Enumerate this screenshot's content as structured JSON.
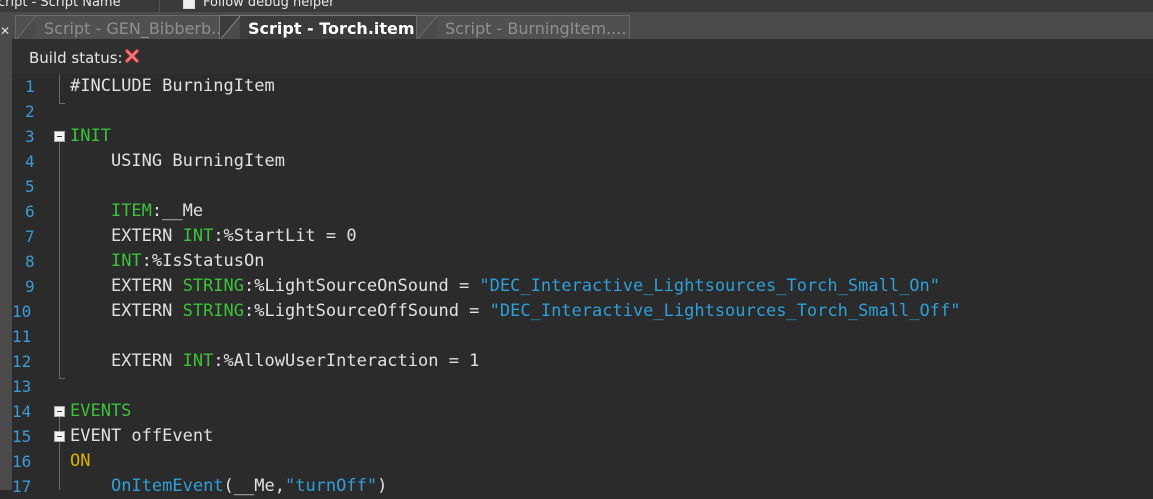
{
  "top_bar": {
    "left_text": "cript - Script Name",
    "right_text": "Follow debug helper"
  },
  "tabs": [
    {
      "label": "Script - GEN_Bibberb...",
      "active": false
    },
    {
      "label": "Script - Torch.item...",
      "active": true
    },
    {
      "label": "Script - BurningItem....",
      "active": false
    }
  ],
  "status": {
    "label": "Build status:",
    "icon": "error-x-icon",
    "icon_color": "#e84a4a"
  },
  "colors": {
    "keyword_green": "#3ac23a",
    "keyword_yellow": "#d9b300",
    "string_blue": "#2e9fd8",
    "line_number": "#3d9ad6",
    "background": "#2b2b2b"
  },
  "lines": [
    {
      "n": "1",
      "tokens": [
        {
          "t": "#INCLUDE BurningItem",
          "c": ""
        }
      ]
    },
    {
      "n": "2",
      "tokens": []
    },
    {
      "n": "3",
      "tokens": [
        {
          "t": "INIT",
          "c": "kw-green"
        }
      ]
    },
    {
      "n": "4",
      "tokens": [
        {
          "t": "    USING BurningItem",
          "c": ""
        }
      ]
    },
    {
      "n": "5",
      "tokens": []
    },
    {
      "n": "6",
      "tokens": [
        {
          "t": "    ",
          "c": ""
        },
        {
          "t": "ITEM",
          "c": "kw-green"
        },
        {
          "t": ":__Me",
          "c": ""
        }
      ]
    },
    {
      "n": "7",
      "tokens": [
        {
          "t": "    EXTERN ",
          "c": ""
        },
        {
          "t": "INT",
          "c": "kw-green"
        },
        {
          "t": ":%StartLit = 0",
          "c": ""
        }
      ]
    },
    {
      "n": "8",
      "tokens": [
        {
          "t": "    ",
          "c": ""
        },
        {
          "t": "INT",
          "c": "kw-green"
        },
        {
          "t": ":%IsStatusOn",
          "c": ""
        }
      ]
    },
    {
      "n": "9",
      "tokens": [
        {
          "t": "    EXTERN ",
          "c": ""
        },
        {
          "t": "STRING",
          "c": "kw-green"
        },
        {
          "t": ":%LightSourceOnSound = ",
          "c": ""
        },
        {
          "t": "\"DEC_Interactive_Lightsources_Torch_Small_On\"",
          "c": "str"
        }
      ]
    },
    {
      "n": "10",
      "tokens": [
        {
          "t": "    EXTERN ",
          "c": ""
        },
        {
          "t": "STRING",
          "c": "kw-green"
        },
        {
          "t": ":%LightSourceOffSound = ",
          "c": ""
        },
        {
          "t": "\"DEC_Interactive_Lightsources_Torch_Small_Off\"",
          "c": "str"
        }
      ]
    },
    {
      "n": "11",
      "tokens": []
    },
    {
      "n": "12",
      "tokens": [
        {
          "t": "    EXTERN ",
          "c": ""
        },
        {
          "t": "INT",
          "c": "kw-green"
        },
        {
          "t": ":%AllowUserInteraction = 1",
          "c": ""
        }
      ]
    },
    {
      "n": "13",
      "tokens": []
    },
    {
      "n": "14",
      "tokens": [
        {
          "t": "EVENTS",
          "c": "kw-green"
        }
      ]
    },
    {
      "n": "15",
      "tokens": [
        {
          "t": "EVENT offEvent",
          "c": ""
        }
      ]
    },
    {
      "n": "16",
      "tokens": [
        {
          "t": "ON",
          "c": "kw-yellow"
        }
      ]
    },
    {
      "n": "17",
      "tokens": [
        {
          "t": "    ",
          "c": ""
        },
        {
          "t": "OnItemEvent",
          "c": "fn"
        },
        {
          "t": "(__Me,",
          "c": ""
        },
        {
          "t": "\"turnOff\"",
          "c": "str"
        },
        {
          "t": ")",
          "c": ""
        }
      ]
    }
  ]
}
